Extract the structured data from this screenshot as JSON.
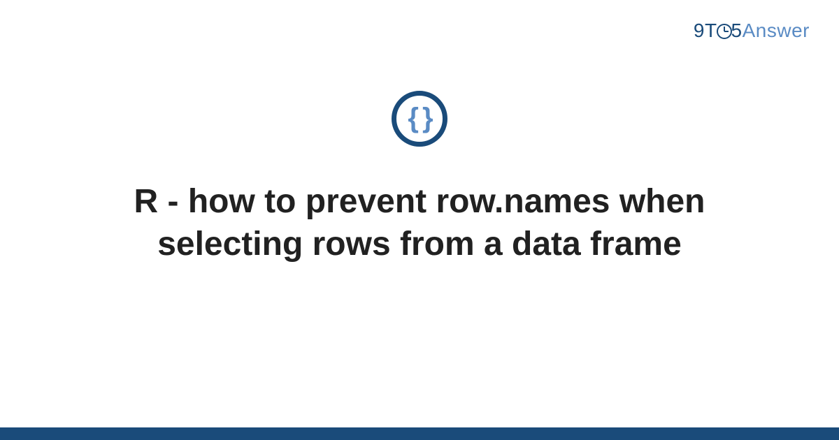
{
  "brand": {
    "part1": "9",
    "part2": "T",
    "part3": "5",
    "part4": "Answer"
  },
  "icon": {
    "braces": "{ }"
  },
  "title": "R - how to prevent row.names when selecting rows from a data frame",
  "colors": {
    "primary": "#1a4b7a",
    "secondary": "#5a8bc4",
    "text": "#212121"
  }
}
